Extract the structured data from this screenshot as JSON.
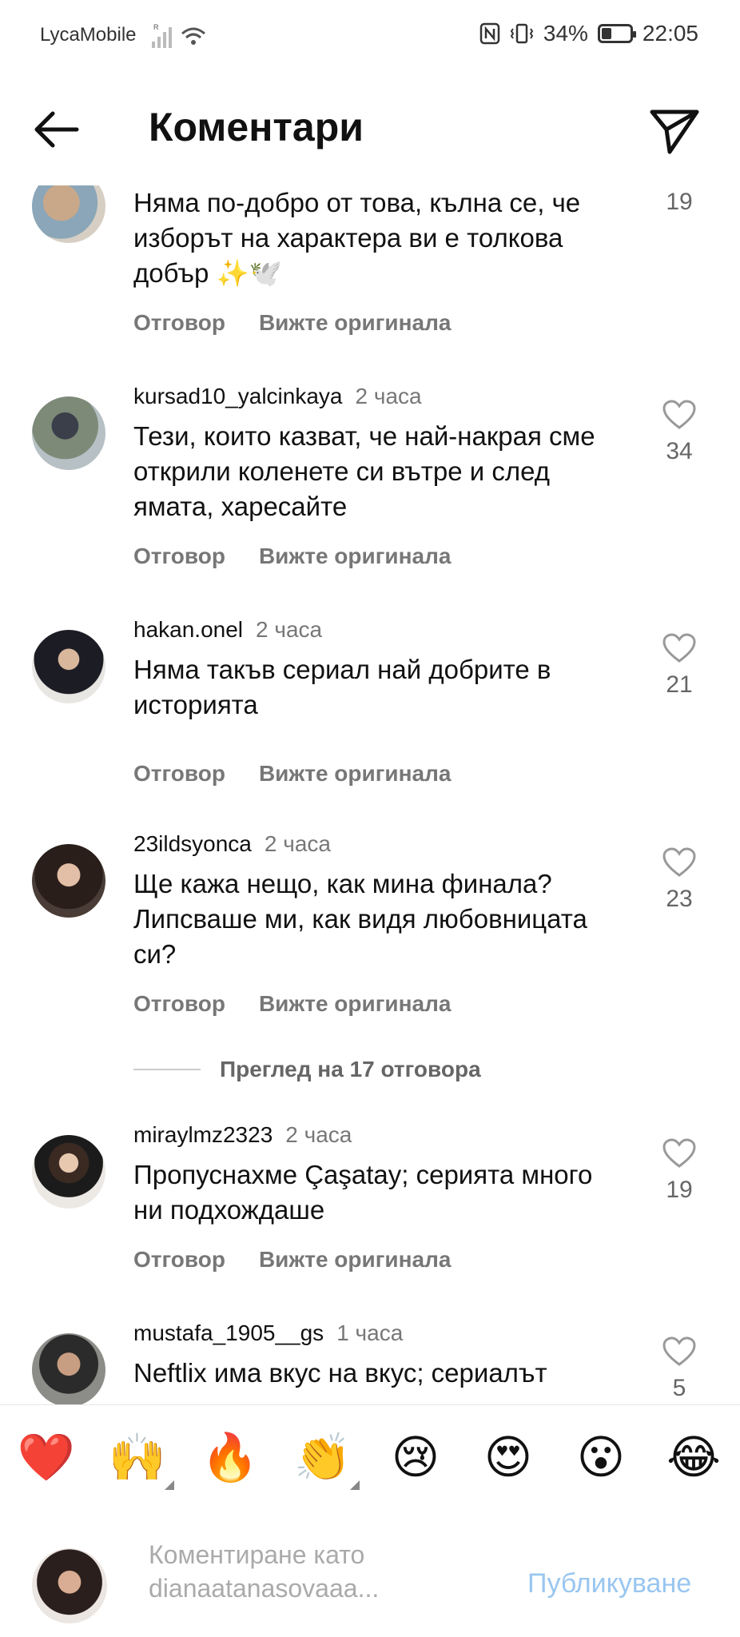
{
  "status_bar": {
    "carrier": "LycaMobile",
    "battery_percent": "34%",
    "battery_level": 0.34,
    "time": "22:05"
  },
  "header": {
    "title": "Коментари",
    "back_icon": "arrow-left-icon",
    "send_icon": "paper-plane-icon"
  },
  "comments": [
    {
      "user": "",
      "time": "",
      "text": "Няма по-добро от това, кълна се, че изборът на характера ви е толкова добър ✨🕊️",
      "likes": "19",
      "reply_label": "Отговор",
      "original_label": "Вижте оригинала"
    },
    {
      "user": "kursad10_yalcinkaya",
      "time": "2 часа",
      "text": "Тези, които казват, че най-накрая сме открили коленете си вътре и след ямата, харесайте",
      "likes": "34",
      "reply_label": "Отговор",
      "original_label": "Вижте оригинала"
    },
    {
      "user": "hakan.onel",
      "time": "2 часа",
      "text": "Няма такъв сериал най добрите в историята",
      "likes": "21",
      "reply_label": "Отговор",
      "original_label": "Вижте оригинала"
    },
    {
      "user": "23ildsyonca",
      "time": "2 часа",
      "text": "Ще кажа нещо, как мина финала? Липсваше ми, как видя любовницата си?",
      "likes": "23",
      "reply_label": "Отговор",
      "original_label": "Вижте оригинала",
      "view_replies": "Преглед на 17 отговора"
    },
    {
      "user": "miraylmz2323",
      "time": "2 часа",
      "text": "Пропуснахме Çaşatay; серията много ни подхождаше",
      "likes": "19",
      "reply_label": "Отговор",
      "original_label": "Вижте оригинала"
    },
    {
      "user": "mustafa_1905__gs",
      "time": "1 часа",
      "text": "Neftlix има вкус на вкус; сериалът",
      "likes": "5"
    }
  ],
  "emoji_bar": [
    "❤️",
    "🙌",
    "🔥",
    "👏",
    "😢",
    "😍",
    "😮",
    "😂"
  ],
  "composer": {
    "placeholder": "Коментиране като dianaatanasovaaa...",
    "publish_label": "Публикуване"
  },
  "colors": {
    "accent_disabled": "#99c6f0",
    "muted_text": "#777777"
  }
}
